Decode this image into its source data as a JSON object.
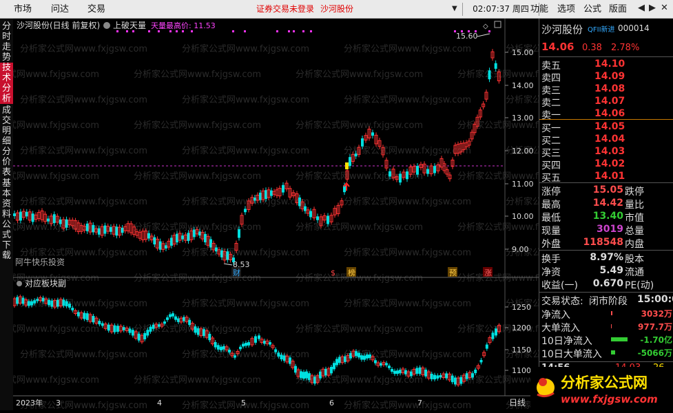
{
  "menu": {
    "items": [
      "市场",
      "问达",
      "交易"
    ],
    "warning": "证券交易未登录",
    "stock_link": "沙河股份"
  },
  "clock": {
    "time": "02:07:37",
    "weekday": "周四"
  },
  "right_menu": [
    "功能",
    "选项",
    "公式",
    "版面"
  ],
  "window_buttons": [
    "◀",
    "▶",
    "✕"
  ],
  "left_tabs": [
    {
      "label": "分时走势",
      "active": false
    },
    {
      "label": "技术分析",
      "active": true
    },
    {
      "label": "成交明细",
      "active": false
    },
    {
      "label": "分价表",
      "active": false
    },
    {
      "label": "基本资料",
      "active": false
    },
    {
      "label": "公式下载",
      "active": false
    }
  ],
  "main_chart": {
    "title": "沙河股份(日线 前复权)",
    "indicator": "上破天量",
    "tianliang_label": "天量最高价: 11.53",
    "high_label": "15.60",
    "low_label": "8.53",
    "bottom_tag": "阿牛快乐投资",
    "y_ticks": [
      "15.00",
      "14.00",
      "13.00",
      "12.00",
      "11.00",
      "10.00",
      "9.00"
    ],
    "markers": [
      "财",
      "$",
      "榜",
      "预",
      "涨"
    ],
    "watermark": "分析家公式网www.fxjgsw.com"
  },
  "sub_chart": {
    "title": "对应板块副",
    "y_ticks": [
      "1250",
      "1200",
      "1150",
      "1100"
    ]
  },
  "x_axis": {
    "labels": [
      "2023年",
      "3",
      "4",
      "5",
      "6",
      "7"
    ],
    "period": "日线"
  },
  "quote": {
    "name": "沙河股份",
    "tag": "QFII新进",
    "code": "000014",
    "price": "14.06",
    "change": "0.38",
    "pct": "2.78%",
    "asks": [
      {
        "label": "卖五",
        "price": "14.10"
      },
      {
        "label": "卖四",
        "price": "14.09"
      },
      {
        "label": "卖三",
        "price": "14.08"
      },
      {
        "label": "卖二",
        "price": "14.07"
      },
      {
        "label": "卖一",
        "price": "14.06"
      }
    ],
    "bids": [
      {
        "label": "买一",
        "price": "14.05"
      },
      {
        "label": "买二",
        "price": "14.04"
      },
      {
        "label": "买三",
        "price": "14.03"
      },
      {
        "label": "买四",
        "price": "14.02"
      },
      {
        "label": "买五",
        "price": "14.01"
      }
    ],
    "stats": [
      {
        "label": "涨停",
        "value": "15.05",
        "label2": "跌停",
        "color": "#ff4d4d"
      },
      {
        "label": "最高",
        "value": "14.42",
        "label2": "量比",
        "color": "#ff4d4d"
      },
      {
        "label": "最低",
        "value": "13.40",
        "label2": "市值",
        "color": "#33cc33"
      },
      {
        "label": "现量",
        "value": "3019",
        "label2": "总量",
        "color": "#cc44cc"
      },
      {
        "label": "外盘",
        "value": "118548",
        "label2": "内盘",
        "color": "#ff4d4d"
      }
    ],
    "stats2": [
      {
        "label": "换手",
        "value": "8.97%",
        "label2": "股本"
      },
      {
        "label": "净资",
        "value": "5.49",
        "label2": "流通"
      },
      {
        "label": "收益(一)",
        "value": "0.670",
        "label2": "PE(动)"
      }
    ],
    "trade_status": {
      "label": "交易状态:",
      "value": "闭市阶段",
      "time": "15:00:0"
    },
    "flows": [
      {
        "label": "净流入",
        "value": "3032万",
        "color": "#ff4d4d"
      },
      {
        "label": "大单流入",
        "value": "977.7万",
        "color": "#ff4d4d"
      },
      {
        "label": "10日净流入",
        "value": "-1.70亿",
        "color": "#33cc33"
      },
      {
        "label": "10日大单流入",
        "value": "-5066万",
        "color": "#33cc33"
      }
    ],
    "tick": {
      "time": "14:56",
      "price": "14.03",
      "vol": "26"
    }
  },
  "logo": {
    "text": "分析家公式网",
    "url": "www.fxjgsw.com"
  },
  "colors": {
    "up": "#ff3333",
    "down": "#00e0e0",
    "purple": "#ff44ff",
    "yellow": "#ffe000"
  }
}
